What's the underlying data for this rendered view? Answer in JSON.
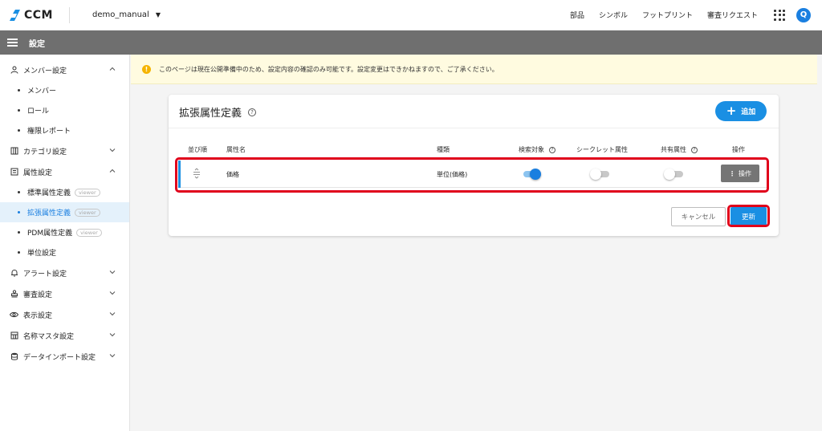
{
  "header": {
    "app_name": "CCM",
    "project": "demo_manual",
    "nav": [
      "部品",
      "シンボル",
      "フットプリント",
      "審査リクエスト"
    ],
    "avatar_letter": "Q",
    "accent_color": "#1a8fe3"
  },
  "subbar": {
    "title": "設定"
  },
  "sidebar": {
    "groups": [
      {
        "label": "メンバー設定",
        "icon": "person-icon",
        "expanded": true,
        "items": [
          {
            "label": "メンバー"
          },
          {
            "label": "ロール"
          },
          {
            "label": "権限レポート"
          }
        ]
      },
      {
        "label": "カテゴリ設定",
        "icon": "category-icon",
        "expanded": false
      },
      {
        "label": "属性設定",
        "icon": "list-icon",
        "expanded": true,
        "items": [
          {
            "label": "標準属性定義",
            "badge": "viewer"
          },
          {
            "label": "拡張属性定義",
            "badge": "viewer",
            "active": true
          },
          {
            "label": "PDM属性定義",
            "badge": "viewer"
          },
          {
            "label": "単位設定"
          }
        ]
      },
      {
        "label": "アラート設定",
        "icon": "bell-icon",
        "expanded": false
      },
      {
        "label": "審査設定",
        "icon": "stamp-icon",
        "expanded": false
      },
      {
        "label": "表示設定",
        "icon": "eye-icon",
        "expanded": false
      },
      {
        "label": "名称マスタ設定",
        "icon": "table-icon",
        "expanded": false
      },
      {
        "label": "データインポート設定",
        "icon": "database-icon",
        "expanded": false
      }
    ]
  },
  "notice": {
    "text": "このページは現在公開準備中のため、設定内容の確認のみ可能です。設定変更はできかねますので、ご了承ください。"
  },
  "card": {
    "title": "拡張属性定義",
    "add_label": "追加",
    "columns": [
      "並び順",
      "属性名",
      "種類",
      "検索対象",
      "シークレット属性",
      "共有属性",
      "操作"
    ],
    "rows": [
      {
        "name": "価格",
        "type": "単位(価格)",
        "searchable": true,
        "secret": false,
        "shared": false,
        "action_label": "操作"
      }
    ],
    "cancel_label": "キャンセル",
    "update_label": "更新"
  }
}
